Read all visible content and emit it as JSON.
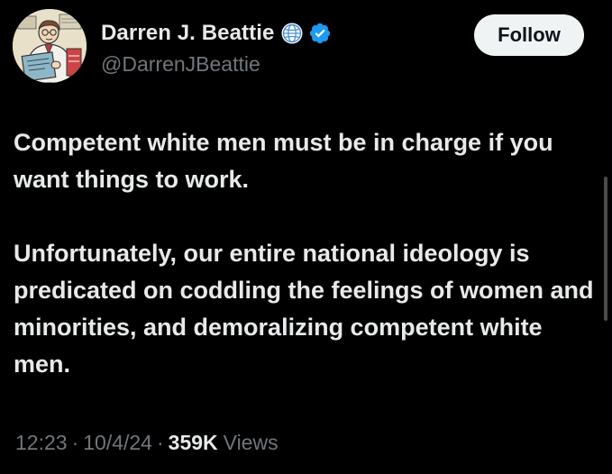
{
  "author": {
    "display_name": "Darren J. Beattie",
    "handle": "@DarrenJBeattie",
    "avatar_icon": "cartoon-reader-avatar",
    "affiliation_icon": "globe-icon",
    "verified_icon": "verified-badge-icon",
    "verified_color": "#1d9bf0"
  },
  "follow_button": {
    "label": "Follow"
  },
  "tweet": {
    "paragraph_1": "Competent white men must be in charge if you want things to work.",
    "paragraph_2": "Unfortunately, our entire national ideology is predicated on coddling the feelings of women and minorities, and demoralizing competent white men."
  },
  "meta": {
    "time": "12:23",
    "separator": "·",
    "date": "10/4/24",
    "views_count": "359K",
    "views_label": "Views"
  },
  "colors": {
    "background": "#000000",
    "primary_text": "#e7e9ea",
    "secondary_text": "#71767b",
    "button_background": "#eff3f4",
    "button_text": "#0f1419"
  }
}
